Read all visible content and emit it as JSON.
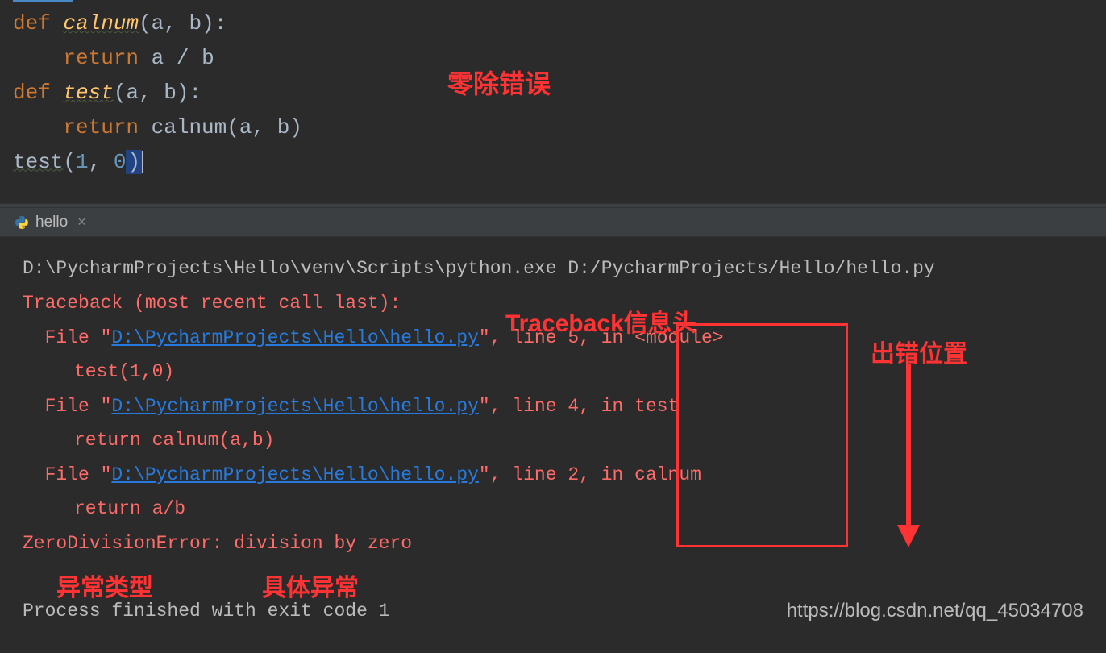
{
  "editor": {
    "code_lines": [
      {
        "indent": "",
        "tokens": [
          {
            "cls": "kw",
            "t": "def "
          },
          {
            "cls": "fn fn-underline",
            "t": "calnum"
          },
          {
            "cls": "paren",
            "t": "("
          },
          {
            "cls": "param",
            "t": "a"
          },
          {
            "cls": "paren",
            "t": ", "
          },
          {
            "cls": "param",
            "t": "b"
          },
          {
            "cls": "paren",
            "t": "):"
          }
        ]
      },
      {
        "indent": "    ",
        "tokens": [
          {
            "cls": "kw",
            "t": "return "
          },
          {
            "cls": "param",
            "t": "a "
          },
          {
            "cls": "op",
            "t": "/ "
          },
          {
            "cls": "param",
            "t": "b"
          }
        ]
      },
      {
        "indent": "",
        "tokens": [
          {
            "cls": "kw",
            "t": "def "
          },
          {
            "cls": "fn fn-underline",
            "t": "test"
          },
          {
            "cls": "paren",
            "t": "("
          },
          {
            "cls": "param",
            "t": "a"
          },
          {
            "cls": "paren",
            "t": ", "
          },
          {
            "cls": "param",
            "t": "b"
          },
          {
            "cls": "paren",
            "t": "):"
          }
        ]
      },
      {
        "indent": "    ",
        "tokens": [
          {
            "cls": "kw",
            "t": "return "
          },
          {
            "cls": "param",
            "t": "calnum"
          },
          {
            "cls": "paren",
            "t": "("
          },
          {
            "cls": "param",
            "t": "a"
          },
          {
            "cls": "paren",
            "t": ", "
          },
          {
            "cls": "param",
            "t": "b"
          },
          {
            "cls": "paren",
            "t": ")"
          }
        ]
      },
      {
        "indent": "",
        "tokens": [
          {
            "cls": "param call-underline",
            "t": "test"
          },
          {
            "cls": "paren",
            "t": "("
          },
          {
            "cls": "num",
            "t": "1"
          },
          {
            "cls": "paren",
            "t": ", "
          },
          {
            "cls": "num",
            "t": "0"
          },
          {
            "cls": "paren caret-highlight",
            "t": ")"
          }
        ]
      }
    ]
  },
  "tab": {
    "name": "hello",
    "close": "×"
  },
  "console": {
    "cmd": "D:\\PycharmProjects\\Hello\\venv\\Scripts\\python.exe D:/PycharmProjects/Hello/hello.py",
    "traceback_header": "Traceback (most recent call last):",
    "frames": [
      {
        "file": "D:\\PycharmProjects\\Hello\\hello.py",
        "line": "5",
        "loc": "<module>",
        "ctx": "test(1,0)"
      },
      {
        "file": "D:\\PycharmProjects\\Hello\\hello.py",
        "line": "4",
        "loc": "test",
        "ctx": "return calnum(a,b)"
      },
      {
        "file": "D:\\PycharmProjects\\Hello\\hello.py",
        "line": "2",
        "loc": "calnum",
        "ctx": "return a/b"
      }
    ],
    "error": "ZeroDivisionError: division by zero",
    "exit": "Process finished with exit code 1"
  },
  "annotations": {
    "a1": "零除错误",
    "a2": "Traceback信息头",
    "a3": "出错位置",
    "a4": "异常类型",
    "a5": "具体异常"
  },
  "watermark": "https://blog.csdn.net/qq_45034708",
  "labels": {
    "file_prefix": "  File ",
    "quote": "\"",
    "line_prefix": ", line ",
    "in_prefix": ", in "
  }
}
